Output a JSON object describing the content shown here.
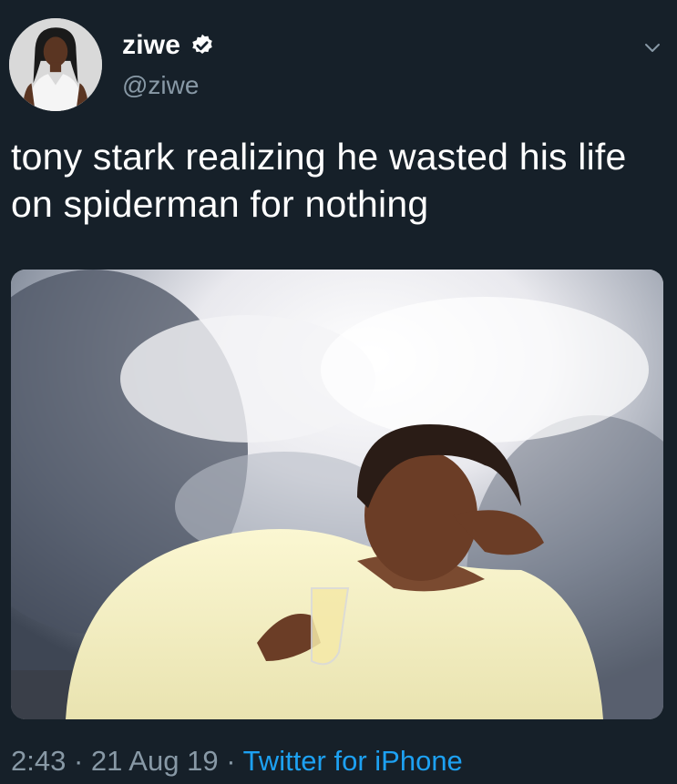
{
  "user": {
    "display_name": "ziwe",
    "handle": "@ziwe",
    "verified": true
  },
  "tweet": {
    "text": "tony stark realizing he wasted his life on spiderman for nothing",
    "time": "2:43",
    "separator": "·",
    "date": "21 Aug 19",
    "source": "Twitter for iPhone"
  },
  "icons": {
    "verified": "verified-badge-icon",
    "menu": "chevron-down-icon"
  },
  "colors": {
    "background": "#15202b",
    "secondary_text": "#8899a6",
    "link": "#1da1f2"
  }
}
